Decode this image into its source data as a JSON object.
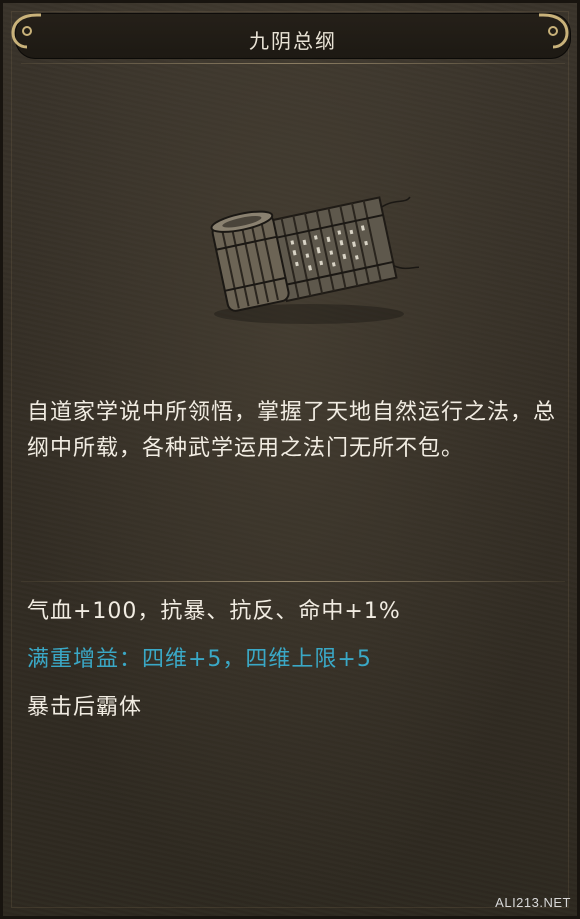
{
  "header": {
    "title": "九阴总纲"
  },
  "item": {
    "icon": "bamboo-scroll-icon",
    "description": "自道家学说中所领悟，掌握了天地自然运行之法，总纲中所载，各种武学运用之法门无所不包。"
  },
  "stats": {
    "line1": "气血+100，抗暴、抗反、命中+1%",
    "line2": "满重增益：四维+5，四维上限+5",
    "line3": "暴击后霸体"
  },
  "colors": {
    "text": "#f1ece2",
    "bonus": "#3aa8c6",
    "background": "#342e25"
  },
  "watermark": {
    "text": "ALI213.NET"
  }
}
